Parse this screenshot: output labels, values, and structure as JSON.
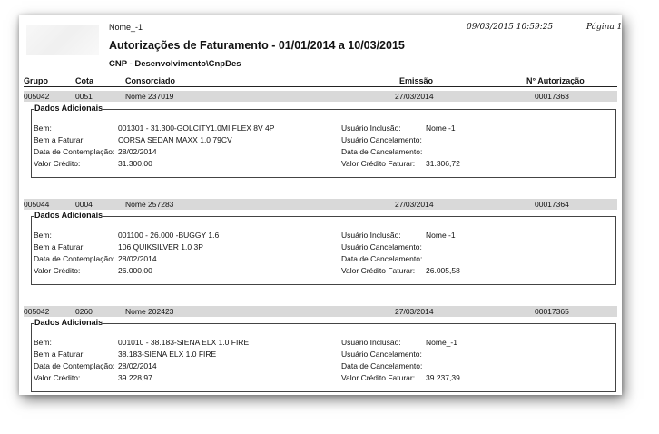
{
  "header": {
    "user": "Nome_-1",
    "timestamp": "09/03/2015 10:59:25",
    "page": "Página 1",
    "title": "Autorizações de Faturamento - 01/01/2014 a 10/03/2015",
    "subtitle": "CNP - Desenvolvimento\\CnpDes"
  },
  "columns": {
    "grupo": "Grupo",
    "cota": "Cota",
    "consorciado": "Consorciado",
    "emissao": "Emissão",
    "autorizacao": "N° Autorização"
  },
  "section_title": "Dados Adicionais",
  "labels": {
    "bem": "Bem:",
    "bem_faturar": "Bem a Faturar:",
    "data_contemplacao": "Data de Contemplação:",
    "valor_credito": "Valor Crédito:",
    "usuario_inclusao": "Usuário Inclusão:",
    "usuario_cancelamento": "Usuário Cancelamento:",
    "data_cancelamento": "Data de Cancelamento:",
    "valor_credito_faturar": "Valor Crédito Faturar:"
  },
  "records": [
    {
      "grupo": "005042",
      "cota": "0051",
      "consorciado": "Nome  237019",
      "emissao": "27/03/2014",
      "autorizacao": "00017363",
      "bem": "001301 - 31.300-GOLCITY1.0MI FLEX 8V 4P",
      "bem_faturar": "CORSA SEDAN MAXX 1.0 79CV",
      "data_contemplacao": "28/02/2014",
      "valor_credito": "31.300,00",
      "usuario_inclusao": "Nome -1",
      "usuario_cancelamento": "",
      "data_cancelamento": "",
      "valor_credito_faturar": "31.306,72"
    },
    {
      "grupo": "005044",
      "cota": "0004",
      "consorciado": "Nome  257283",
      "emissao": "27/03/2014",
      "autorizacao": "00017364",
      "bem": "001100 - 26.000 -BUGGY 1.6",
      "bem_faturar": "106 QUIKSILVER 1.0 3P",
      "data_contemplacao": "28/02/2014",
      "valor_credito": "26.000,00",
      "usuario_inclusao": "Nome -1",
      "usuario_cancelamento": "",
      "data_cancelamento": "",
      "valor_credito_faturar": "26.005,58"
    },
    {
      "grupo": "005042",
      "cota": "0260",
      "consorciado": "Nome  202423",
      "emissao": "27/03/2014",
      "autorizacao": "00017365",
      "bem": "001010 - 38.183-SIENA ELX 1.0 FIRE",
      "bem_faturar": "38.183-SIENA ELX 1.0 FIRE",
      "data_contemplacao": "28/02/2014",
      "valor_credito": "39.228,97",
      "usuario_inclusao": "Nome_-1",
      "usuario_cancelamento": "",
      "data_cancelamento": "",
      "valor_credito_faturar": "39.237,39"
    }
  ]
}
